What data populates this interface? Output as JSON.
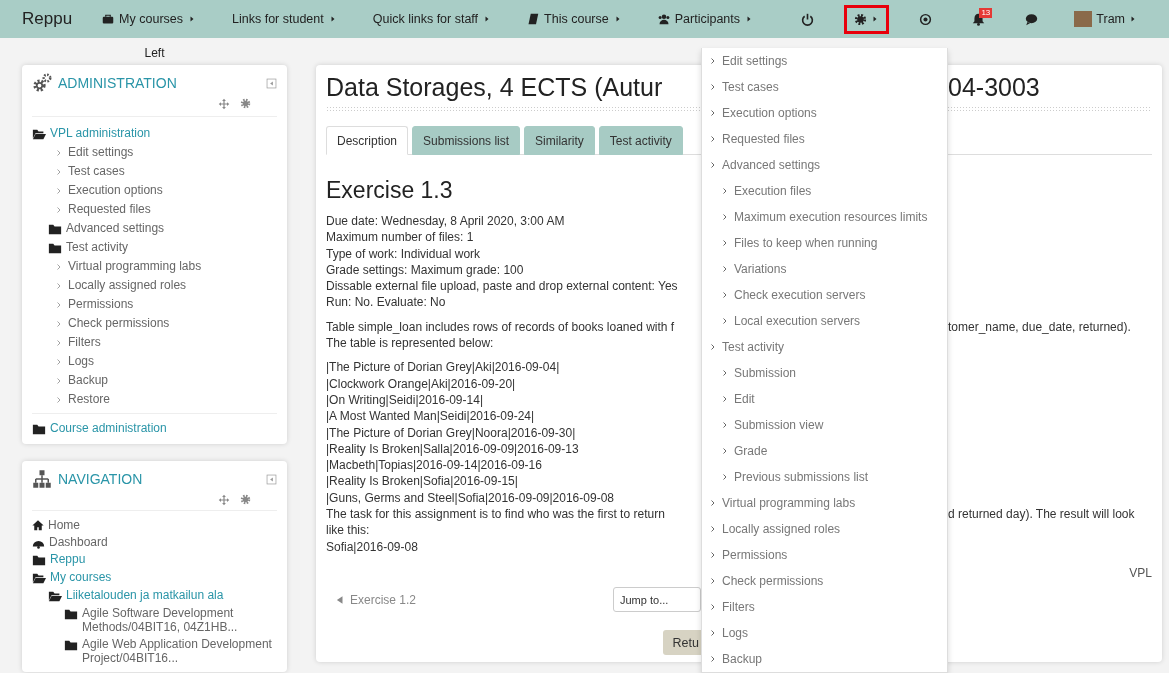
{
  "topbar": {
    "brand": "Reppu",
    "menus": [
      {
        "label": "My courses"
      },
      {
        "label": "Links for student"
      },
      {
        "label": "Quick links for staff"
      },
      {
        "label": "This course"
      },
      {
        "label": "Participants"
      }
    ],
    "tools": [
      {
        "kind": "power",
        "highlighted": false
      },
      {
        "kind": "settings",
        "highlighted": true
      },
      {
        "kind": "target",
        "highlighted": false
      },
      {
        "kind": "notifications",
        "highlighted": false,
        "badge": "13"
      },
      {
        "kind": "messages",
        "highlighted": false
      }
    ],
    "user": {
      "name": "Tram"
    }
  },
  "region_label": "Left",
  "administration": {
    "title": "ADMINISTRATION",
    "items": [
      {
        "label": "VPL administration",
        "kind": "folder",
        "expanded": true,
        "link": true,
        "children": [
          {
            "label": "Edit settings",
            "kind": "leaf",
            "link": false
          },
          {
            "label": "Test cases",
            "kind": "leaf",
            "link": false
          },
          {
            "label": "Execution options",
            "kind": "leaf",
            "link": false
          },
          {
            "label": "Requested files",
            "kind": "leaf",
            "link": false
          },
          {
            "label": "Advanced settings",
            "kind": "folder",
            "expanded": false,
            "link": false
          },
          {
            "label": "Test activity",
            "kind": "folder",
            "expanded": false,
            "link": false
          },
          {
            "label": "Virtual programming labs",
            "kind": "leaf",
            "link": false
          },
          {
            "label": "Locally assigned roles",
            "kind": "leaf",
            "link": false
          },
          {
            "label": "Permissions",
            "kind": "leaf",
            "link": false
          },
          {
            "label": "Check permissions",
            "kind": "leaf",
            "link": false
          },
          {
            "label": "Filters",
            "kind": "leaf",
            "link": false
          },
          {
            "label": "Logs",
            "kind": "leaf",
            "link": false
          },
          {
            "label": "Backup",
            "kind": "leaf",
            "link": false
          },
          {
            "label": "Restore",
            "kind": "leaf",
            "link": false
          }
        ]
      },
      {
        "label": "Course administration",
        "kind": "folder",
        "expanded": false,
        "link": true
      }
    ]
  },
  "navigation": {
    "title": "NAVIGATION",
    "items": [
      {
        "label": "Home",
        "kind": "home",
        "link": false
      },
      {
        "label": "Dashboard",
        "kind": "dashboard",
        "link": false
      },
      {
        "label": "Reppu",
        "kind": "folder",
        "expanded": false,
        "link": true
      },
      {
        "label": "My courses",
        "kind": "folder",
        "expanded": true,
        "link": true,
        "children": [
          {
            "label": "Liiketalouden ja matkailun ala",
            "kind": "folder",
            "expanded": true,
            "link": true,
            "children": [
              {
                "label": "Agile Software Development Methods/04BIT16, 04Z1HB...",
                "kind": "folder",
                "expanded": false,
                "link": false
              },
              {
                "label": "Agile Web Application Development Project/04BIT16...",
                "kind": "folder",
                "expanded": false,
                "link": false
              }
            ]
          }
        ]
      }
    ]
  },
  "card": {
    "title": {
      "left": "Data Storages, 4 ECTS (Autur",
      "right": "04-3003"
    },
    "tabs": [
      {
        "label": "Description",
        "selected": true
      },
      {
        "label": "Submissions list",
        "selected": false
      },
      {
        "label": "Similarity",
        "selected": false
      },
      {
        "label": "Test activity",
        "selected": false
      }
    ],
    "heading": "Exercise 1.3",
    "sections": [
      {
        "lines": [
          {
            "left": "Due date: Wednesday, 8 April 2020, 3:00 AM"
          },
          {
            "left": "Maximum number of files: 1"
          },
          {
            "left": "Type of work: Individual work"
          },
          {
            "left": "Grade settings: Maximum grade: 100"
          },
          {
            "left": "Dissable external file upload, paste and drop external content: Yes"
          },
          {
            "left": "Run: No. Evaluate: No"
          }
        ]
      },
      {
        "lines": [
          {
            "left": "Table simple_loan includes rows of records of books loaned with f",
            "right": "tomer_name, due_date, returned)."
          },
          {
            "left": "The table is represented below:"
          }
        ]
      },
      {
        "lines": [
          {
            "left": "|The Picture of Dorian Grey|Aki|2016-09-04|"
          },
          {
            "left": "|Clockwork Orange|Aki|2016-09-20|"
          },
          {
            "left": "|On Writing|Seidi|2016-09-14|"
          },
          {
            "left": "|A Most Wanted Man|Seidi|2016-09-24|"
          },
          {
            "left": "|The Picture of Dorian Grey|Noora|2016-09-30|"
          },
          {
            "left": "|Reality Is Broken|Salla|2016-09-09|2016-09-13"
          },
          {
            "left": "|Macbeth|Topias|2016-09-14|2016-09-16"
          },
          {
            "left": "|Reality Is Broken|Sofia|2016-09-15|"
          },
          {
            "left": "|Guns, Germs and Steel|Sofia|2016-09-09|2016-09-08"
          },
          {
            "left": "The task for this assignment is to find who was the first to return",
            "right": "d returned day). The result will look"
          },
          {
            "left": "like this:"
          },
          {
            "left": "Sofia|2016-09-08"
          }
        ]
      }
    ],
    "footer_note": "VPL",
    "previous_link": "Exercise 1.2",
    "jump_select": {
      "value": "Jump to..."
    },
    "return_button": "Retu"
  },
  "dropdown": {
    "items": [
      {
        "label": "Edit settings"
      },
      {
        "label": "Test cases"
      },
      {
        "label": "Execution options"
      },
      {
        "label": "Requested files"
      },
      {
        "label": "Advanced settings",
        "children": [
          {
            "label": "Execution files"
          },
          {
            "label": "Maximum execution resources limits"
          },
          {
            "label": "Files to keep when running"
          },
          {
            "label": "Variations"
          },
          {
            "label": "Check execution servers"
          },
          {
            "label": "Local execution servers"
          }
        ]
      },
      {
        "label": "Test activity",
        "children": [
          {
            "label": "Submission"
          },
          {
            "label": "Edit"
          },
          {
            "label": "Submission view"
          },
          {
            "label": "Grade"
          },
          {
            "label": "Previous submissions list"
          }
        ]
      },
      {
        "label": "Virtual programming labs"
      },
      {
        "label": "Locally assigned roles"
      },
      {
        "label": "Permissions"
      },
      {
        "label": "Check permissions"
      },
      {
        "label": "Filters"
      },
      {
        "label": "Logs"
      },
      {
        "label": "Backup"
      }
    ]
  }
}
